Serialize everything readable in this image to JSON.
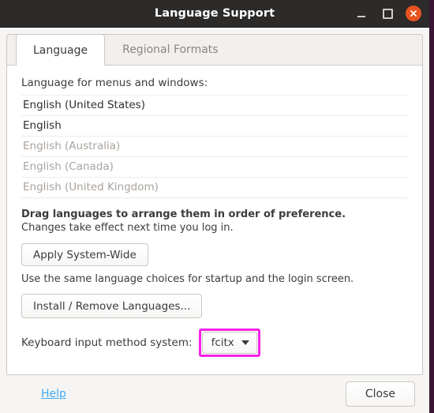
{
  "window": {
    "title": "Language Support",
    "controls": {
      "minimize": "minimize-icon",
      "maximize": "maximize-icon",
      "close": "close-icon"
    },
    "close_button_color": "#e8531f",
    "titlebar_color": "#2d2b2a"
  },
  "tabs": [
    {
      "label": "Language",
      "active": true
    },
    {
      "label": "Regional Formats",
      "active": false
    }
  ],
  "language_section": {
    "label": "Language for menus and windows:",
    "items": [
      {
        "name": "English (United States)",
        "enabled": true
      },
      {
        "name": "English",
        "enabled": true
      },
      {
        "name": "English (Australia)",
        "enabled": false
      },
      {
        "name": "English (Canada)",
        "enabled": false
      },
      {
        "name": "English (United Kingdom)",
        "enabled": false
      }
    ],
    "hint_bold": "Drag languages to arrange them in order of preference.",
    "hint_normal": "Changes take effect next time you log in."
  },
  "apply": {
    "button_label": "Apply System-Wide",
    "description": "Use the same language choices for startup and the login screen."
  },
  "install": {
    "button_label": "Install / Remove Languages..."
  },
  "input_method": {
    "label": "Keyboard input method system:",
    "selected": "fcitx",
    "caret": "chevron-down-icon",
    "highlight_color": "#f522e8"
  },
  "footer": {
    "help_label": "Help",
    "help_color": "#3eaaf0",
    "close_label": "Close"
  }
}
